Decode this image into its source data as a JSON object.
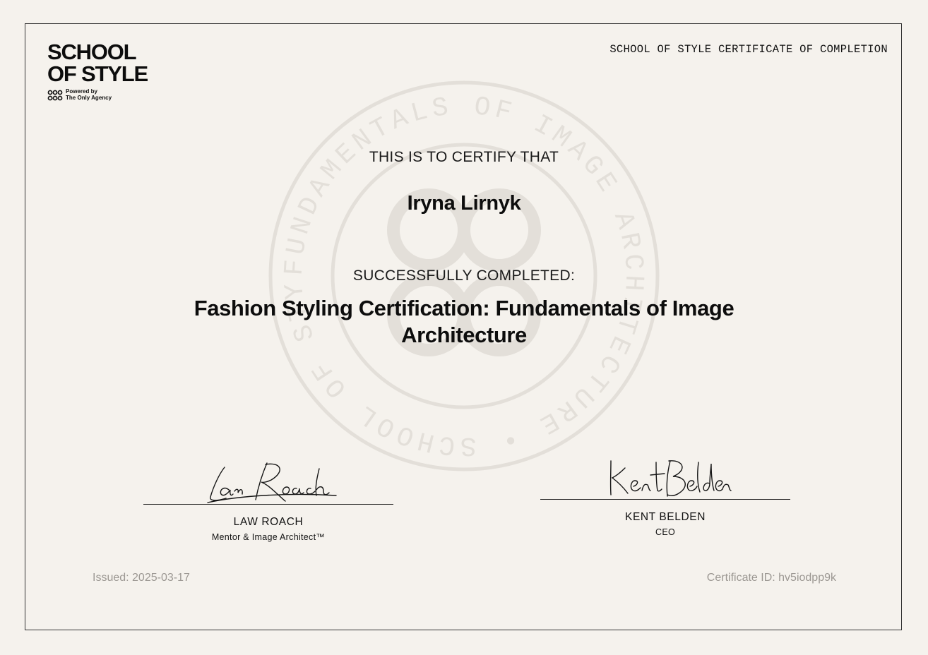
{
  "brand": {
    "line1": "SCHOOL",
    "line2": "OF STYLE",
    "powered_line1": "Powered by",
    "powered_line2": "The Only Agency"
  },
  "header": {
    "title": "SCHOOL OF STYLE CERTIFICATE OF COMPLETION"
  },
  "seal": {
    "text": "FUNDAMENTALS OF IMAGE ARCHITECTURE • SCHOOL OF STYLE"
  },
  "certificate": {
    "certify_text": "THIS IS TO CERTIFY THAT",
    "recipient": "Iryna Lirnyk",
    "completed_text": "SUCCESSFULLY COMPLETED:",
    "course": "Fashion Styling Certification: Fundamentals of Image Architecture"
  },
  "signatories": [
    {
      "name": "LAW ROACH",
      "role": "Mentor & Image Architect™",
      "signature": "Law Roach"
    },
    {
      "name": "KENT BELDEN",
      "role": "CEO",
      "signature": "Kent Belden"
    }
  ],
  "footer": {
    "issued": "Issued: 2025-03-17",
    "certificate_id": "Certificate ID: hv5iodpp9k"
  },
  "colors": {
    "background": "#f5f2ed",
    "ink": "#111111",
    "seal": "#e3dfd9",
    "muted": "#9c9893"
  }
}
